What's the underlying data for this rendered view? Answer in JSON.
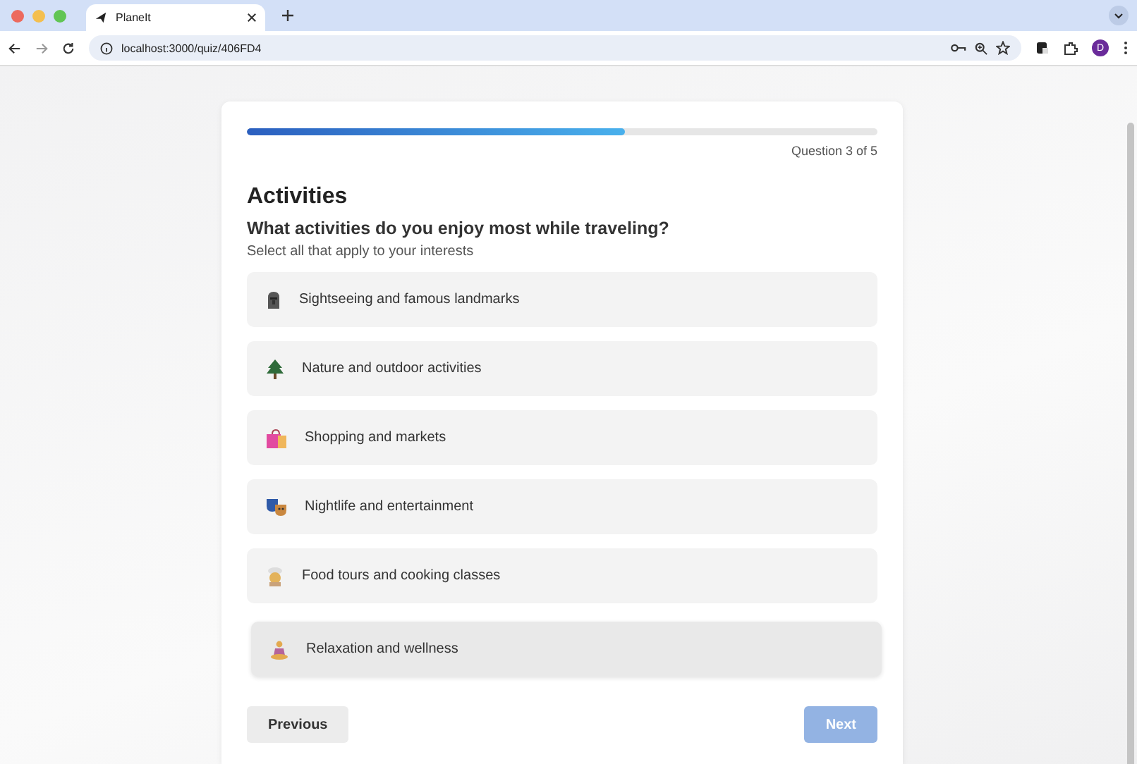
{
  "browser": {
    "tab_title": "PlaneIt",
    "url": "localhost:3000/quiz/406FD4",
    "profile_initial": "D"
  },
  "quiz": {
    "progress": {
      "level": 0.6
    },
    "counter": "Question 3 of 5",
    "title": "Activities",
    "question": "What activities do you enjoy most while traveling?",
    "hint": "Select all that apply to your interests",
    "options": [
      {
        "kind": "statue",
        "label": "Sightseeing and famous landmarks",
        "selected": false,
        "hovered": false
      },
      {
        "kind": "tree",
        "label": "Nature and outdoor activities",
        "selected": false,
        "hovered": false
      },
      {
        "kind": "bags",
        "label": "Shopping and markets",
        "selected": false,
        "hovered": false
      },
      {
        "kind": "masks",
        "label": "Nightlife and entertainment",
        "selected": false,
        "hovered": false
      },
      {
        "kind": "chef",
        "label": "Food tours and cooking classes",
        "selected": false,
        "hovered": false
      },
      {
        "kind": "lotus",
        "label": "Relaxation and wellness",
        "selected": false,
        "hovered": true
      }
    ],
    "buttons": {
      "previous": {
        "label": "Previous",
        "disabled": false
      },
      "next": {
        "label": "Next",
        "disabled": true
      }
    }
  }
}
